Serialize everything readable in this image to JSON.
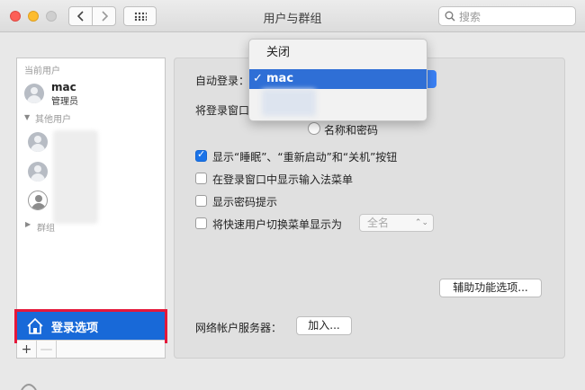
{
  "window": {
    "title": "用户与群组",
    "search_placeholder": "搜索"
  },
  "sidebar": {
    "current_users_label": "当前用户",
    "current_user": {
      "name": "mac",
      "role": "管理员"
    },
    "other_users_label": "其他用户",
    "groups_label": "群组",
    "login_options_label": "登录选项",
    "add_label": "+",
    "remove_label": "—"
  },
  "main": {
    "auto_login_label": "自动登录：",
    "login_window_label": "将登录窗口",
    "name_password_option": "名称和密码",
    "checkboxes": [
      {
        "label": "显示“睡眠”、“重新启动”和“关机”按钮",
        "checked": true
      },
      {
        "label": "在登录窗口中显示输入法菜单",
        "checked": false
      },
      {
        "label": "显示密码提示",
        "checked": false
      },
      {
        "label": "将快速用户切换菜单显示为",
        "checked": false
      }
    ],
    "fast_switch_value": "全名",
    "accessibility_button": "辅助功能选项...",
    "network_server_label": "网络帐户服务器：",
    "join_button": "加入..."
  },
  "menu": {
    "items": [
      {
        "label": "关闭",
        "selected": false
      },
      {
        "label": "mac",
        "selected": true,
        "check": "✓"
      }
    ]
  },
  "colors": {
    "selection_blue": "#1869d8",
    "highlight_red": "#e4183a",
    "checkbox_blue": "#1a73e8"
  }
}
